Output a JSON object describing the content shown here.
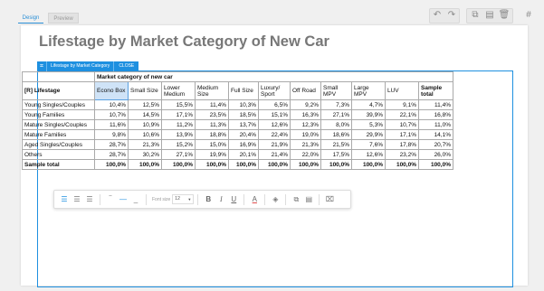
{
  "tabs": {
    "design": "Design",
    "preview": "Preview"
  },
  "toolbar": {
    "undo_icon": "undo-icon",
    "redo_icon": "redo-icon",
    "duplicate_icon": "duplicate-icon",
    "paste_icon": "paste-icon",
    "delete_icon": "delete-icon",
    "grid_icon": "grid-icon"
  },
  "page": {
    "title": "Lifestage by Market Category of New Car"
  },
  "frame": {
    "label": "Lifestage by Market Category",
    "close": "CLOSE"
  },
  "table": {
    "group_header": "Market category of new car",
    "row_header": "[R] Lifestage",
    "columns": [
      "Econo Box",
      "Small Size",
      "Lower Medium",
      "Medium Size",
      "Full Size",
      "Luxury/ Sport",
      "Off Road",
      "Small MPV",
      "Large MPV",
      "LUV",
      "Sample total"
    ],
    "rows": [
      {
        "label": "Young Singles/Couples",
        "values": [
          "10,4%",
          "12,5%",
          "15,5%",
          "11,4%",
          "10,3%",
          "6,5%",
          "9,2%",
          "7,3%",
          "4,7%",
          "9,1%",
          "11,4%"
        ]
      },
      {
        "label": "Young Families",
        "values": [
          "10,7%",
          "14,5%",
          "17,1%",
          "23,5%",
          "18,5%",
          "15,1%",
          "16,3%",
          "27,1%",
          "39,9%",
          "22,1%",
          "16,8%"
        ]
      },
      {
        "label": "Mature Singles/Couples",
        "values": [
          "11,6%",
          "10,9%",
          "11,2%",
          "11,3%",
          "13,7%",
          "12,6%",
          "12,3%",
          "8,0%",
          "5,3%",
          "10,7%",
          "11,0%"
        ]
      },
      {
        "label": "Mature Families",
        "values": [
          "9,8%",
          "10,6%",
          "13,9%",
          "18,8%",
          "20,4%",
          "22,4%",
          "19,0%",
          "18,6%",
          "29,9%",
          "17,1%",
          "14,1%"
        ]
      },
      {
        "label": "Aged Singles/Couples",
        "values": [
          "28,7%",
          "21,3%",
          "15,2%",
          "15,0%",
          "16,9%",
          "21,9%",
          "21,3%",
          "21,5%",
          "7,6%",
          "17,8%",
          "20,7%"
        ]
      },
      {
        "label": "Others",
        "values": [
          "28,7%",
          "30,2%",
          "27,1%",
          "19,9%",
          "20,1%",
          "21,4%",
          "22,0%",
          "17,5%",
          "12,6%",
          "23,2%",
          "26,0%"
        ]
      },
      {
        "label": "Sample total",
        "values": [
          "100,0%",
          "100,0%",
          "100,0%",
          "100,0%",
          "100,0%",
          "100,0%",
          "100,0%",
          "100,0%",
          "100,0%",
          "100,0%",
          "100,0%"
        ],
        "total": true
      }
    ]
  },
  "format_bar": {
    "font_size_label": "Font size",
    "font_size_value": "12",
    "bold": "B",
    "italic": "I",
    "underline": "U",
    "font_color": "A"
  }
}
